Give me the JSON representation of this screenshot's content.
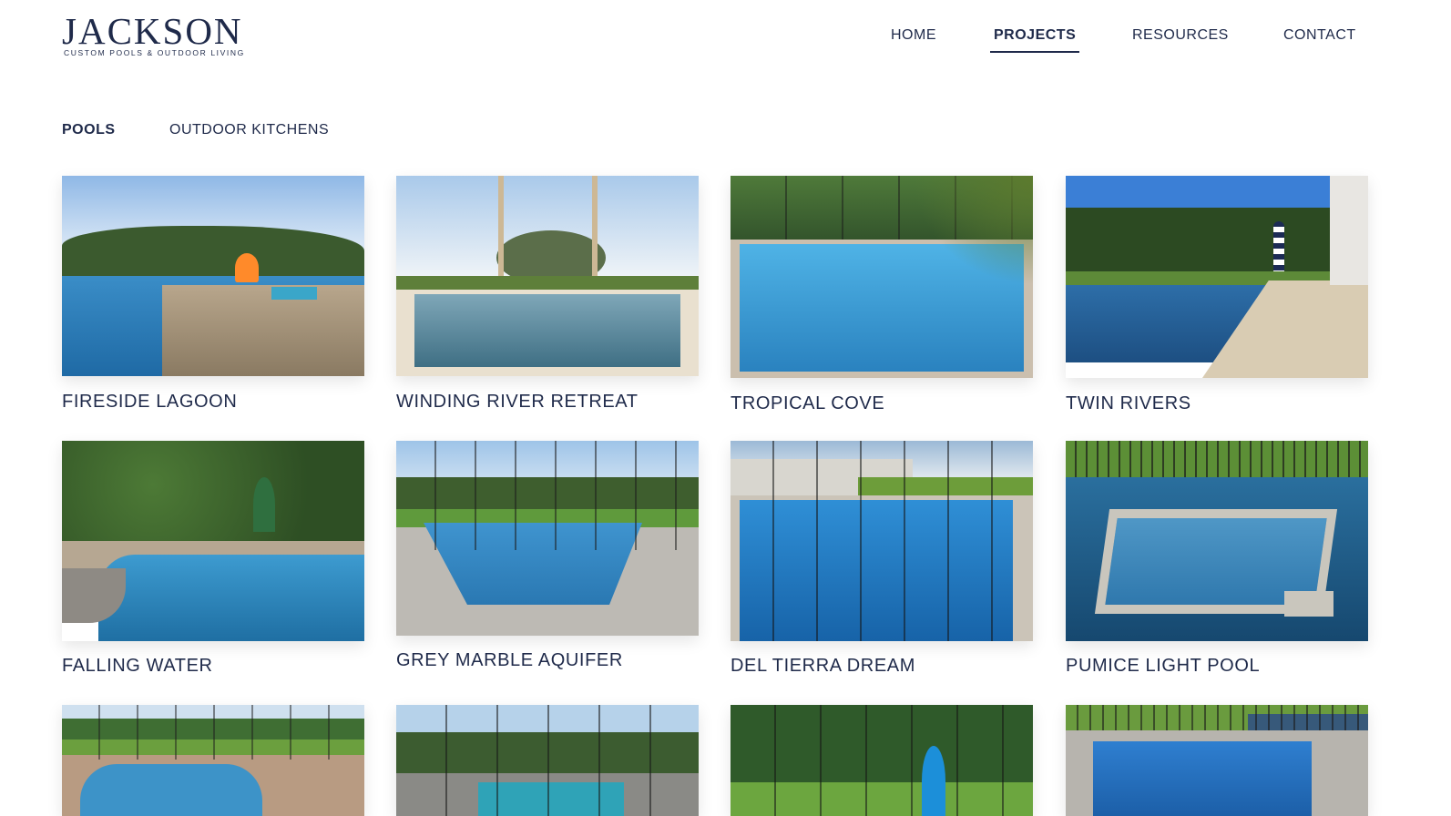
{
  "brand": {
    "wordmark": "JACKSON",
    "tagline": "CUSTOM POOLS & OUTDOOR LIVING"
  },
  "nav": {
    "items": [
      {
        "label": "HOME",
        "active": false
      },
      {
        "label": "PROJECTS",
        "active": true
      },
      {
        "label": "RESOURCES",
        "active": false
      },
      {
        "label": "CONTACT",
        "active": false
      }
    ]
  },
  "tabs": {
    "items": [
      {
        "label": "POOLS",
        "active": true
      },
      {
        "label": "OUTDOOR KITCHENS",
        "active": false
      }
    ]
  },
  "projects": [
    {
      "title": "FIRESIDE LAGOON"
    },
    {
      "title": "WINDING RIVER RETREAT"
    },
    {
      "title": "TROPICAL COVE"
    },
    {
      "title": "TWIN RIVERS"
    },
    {
      "title": "FALLING WATER"
    },
    {
      "title": "GREY MARBLE AQUIFER"
    },
    {
      "title": "DEL TIERRA DREAM"
    },
    {
      "title": "PUMICE LIGHT POOL"
    },
    {
      "title": ""
    },
    {
      "title": ""
    },
    {
      "title": ""
    },
    {
      "title": ""
    }
  ],
  "colors": {
    "brand_navy": "#1f2a4a",
    "pool_blue": "#2f7fb8",
    "sky": "#c9def2",
    "foliage": "#2f4f2a"
  }
}
